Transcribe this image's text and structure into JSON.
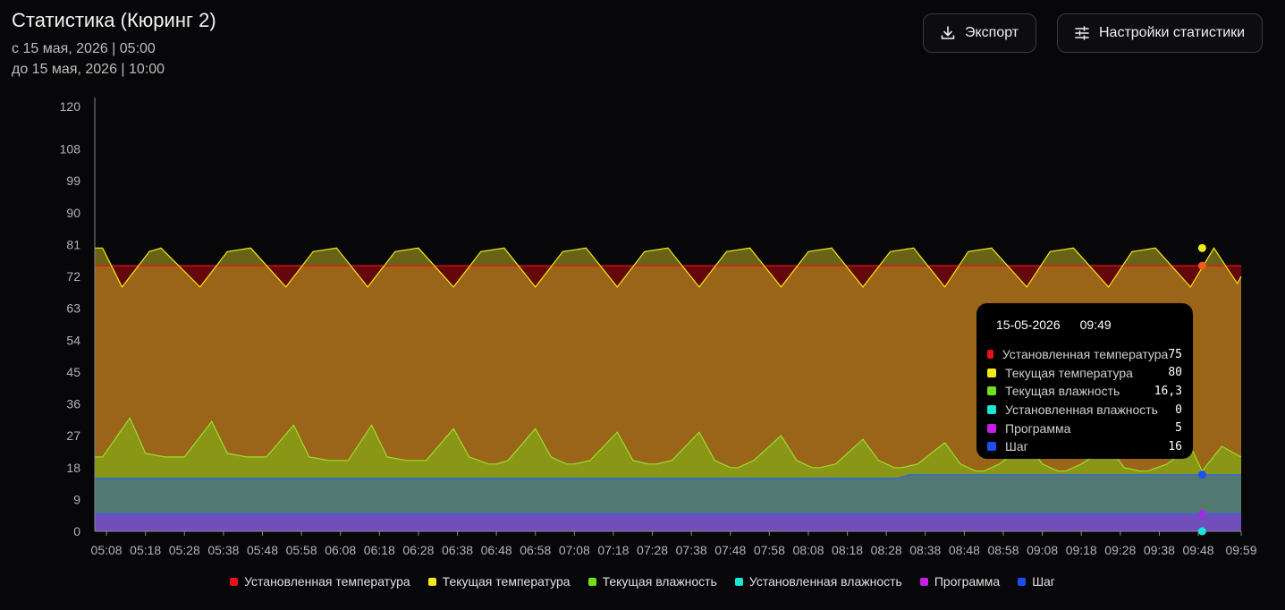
{
  "header": {
    "title": "Статистика (Кюринг 2)",
    "from": "с 15 мая, 2026 | 05:00",
    "to": "до 15 мая, 2026 | 10:00"
  },
  "toolbar": {
    "export_label": "Экспорт",
    "settings_label": "Настройки статистики"
  },
  "tooltip": {
    "date": "15-05-2026",
    "time": "09:49",
    "rows": [
      {
        "label": "Установленная температура",
        "value": "75",
        "color": "#e8101a"
      },
      {
        "label": "Текущая температура",
        "value": "80",
        "color": "#f2ea1a"
      },
      {
        "label": "Текущая влажность",
        "value": "16,3",
        "color": "#6ee11b"
      },
      {
        "label": "Установленная влажность",
        "value": "0",
        "color": "#19e6d6"
      },
      {
        "label": "Программа",
        "value": "5",
        "color": "#c81ee6"
      },
      {
        "label": "Шаг",
        "value": "16",
        "color": "#1c4ff0"
      }
    ]
  },
  "chart_data": {
    "type": "area",
    "ylim": [
      0,
      120
    ],
    "yticks": [
      0,
      9,
      18,
      27,
      36,
      45,
      54,
      63,
      72,
      81,
      90,
      99,
      108,
      120
    ],
    "x_ticks": [
      "05:08",
      "05:18",
      "05:28",
      "05:38",
      "05:48",
      "05:58",
      "06:08",
      "06:18",
      "06:28",
      "06:38",
      "06:48",
      "06:58",
      "07:08",
      "07:18",
      "07:28",
      "07:38",
      "07:48",
      "07:58",
      "08:08",
      "08:18",
      "08:28",
      "08:38",
      "08:48",
      "08:58",
      "09:08",
      "09:18",
      "09:28",
      "09:38",
      "09:48",
      "09:59"
    ],
    "x_range_minutes": [
      305,
      599
    ],
    "legend_position": "bottom",
    "grid": false,
    "series": [
      {
        "name": "Установленная температура",
        "color": "#e8101a",
        "times": [
          305,
          599
        ],
        "values": [
          75,
          75
        ]
      },
      {
        "name": "Текущая температура",
        "color": "#f2ea1a",
        "times": [
          305,
          307,
          312,
          319,
          322,
          332,
          339,
          345,
          354,
          361,
          367,
          375,
          382,
          388,
          397,
          404,
          410,
          418,
          425,
          431,
          439,
          446,
          452,
          460,
          467,
          473,
          481,
          488,
          494,
          502,
          509,
          515,
          523,
          529,
          535,
          544,
          550,
          556,
          565,
          571,
          577,
          586,
          592,
          598,
          599
        ],
        "values": [
          80,
          80,
          69,
          79,
          80,
          69,
          79,
          80,
          69,
          79,
          80,
          69,
          79,
          80,
          69,
          79,
          80,
          69,
          79,
          80,
          69,
          79,
          80,
          69,
          79,
          80,
          69,
          79,
          80,
          69,
          79,
          80,
          69,
          79,
          80,
          69,
          79,
          80,
          69,
          79,
          80,
          69,
          80,
          70,
          72
        ]
      },
      {
        "name": "Текущая влажность",
        "color": "#6ee11b",
        "times": [
          305,
          307,
          314,
          318,
          323,
          325,
          328,
          335,
          339,
          344,
          346,
          349,
          356,
          360,
          365,
          367,
          370,
          376,
          380,
          385,
          387,
          390,
          397,
          401,
          406,
          408,
          411,
          418,
          422,
          426,
          428,
          432,
          439,
          443,
          447,
          449,
          453,
          460,
          464,
          468,
          470,
          474,
          481,
          485,
          489,
          491,
          495,
          502,
          506,
          510,
          512,
          516,
          523,
          527,
          531,
          533,
          537,
          544,
          548,
          552,
          554,
          558,
          565,
          569,
          573,
          575,
          580,
          586,
          589,
          594,
          599
        ],
        "values": [
          21,
          21,
          32,
          22,
          21,
          21,
          21,
          31,
          22,
          21,
          21,
          21,
          30,
          21,
          20,
          20,
          20,
          30,
          21,
          20,
          20,
          20,
          29,
          21,
          19,
          19,
          20,
          29,
          21,
          19,
          19,
          20,
          28,
          20,
          19,
          19,
          20,
          28,
          20,
          18,
          18,
          20,
          27,
          20,
          18,
          18,
          19,
          26,
          20,
          18,
          18,
          19,
          25,
          19,
          17,
          17,
          19,
          25,
          19,
          17,
          17,
          19,
          24,
          18,
          17,
          17,
          19,
          24,
          17,
          24,
          21
        ]
      },
      {
        "name": "Установленная влажность",
        "color": "#19e6d6",
        "times": [
          305,
          599
        ],
        "values": [
          0,
          0
        ]
      },
      {
        "name": "Программа",
        "color": "#c81ee6",
        "times": [
          305,
          599
        ],
        "values": [
          5,
          5
        ]
      },
      {
        "name": "Шаг",
        "color": "#1c4ff0",
        "times": [
          305,
          511,
          514,
          599
        ],
        "values": [
          15,
          15,
          16,
          16
        ]
      }
    ],
    "hover": {
      "time": 589,
      "markers": [
        80,
        75,
        16,
        5,
        0
      ]
    }
  }
}
